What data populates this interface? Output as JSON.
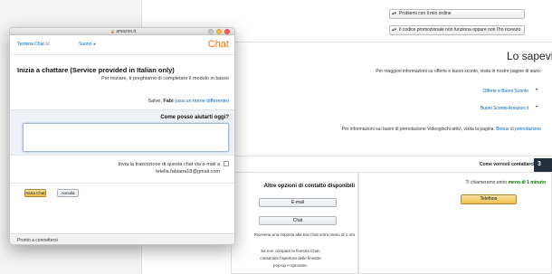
{
  "background": {
    "select1": "Problemi con il mio ordine",
    "select2": "Il codice promozionale non funziona oppure non l'ho ricevuto",
    "section_title": "Lo sapevi?",
    "info_text": "Per maggiori informazioni su offerte e buoni sconto, visita le nostre pagine di aiuto:",
    "link1": "Offerte e Buoni Sconto",
    "link2": "Buoni Sconto Amazon.it",
    "info2_prefix": "Per informazioni sui buoni di prenotazione Videogiochi attivi, visita la pagina:",
    "info2_link": "Bonus di prenotazione",
    "bar_label": "Come vorresti contattarci?",
    "bar_number": "3",
    "right_text_prefix": "Ti chiameremo entro",
    "right_text_bold": "meno di 1 minuto",
    "phone_button": "Telefono",
    "alt_title": "Altre opzioni di contatto disponibili",
    "email_button": "E-mail",
    "chat_button": "Chat",
    "alt_note": "Riceverai una risposta alla tua Chat entro meno di 1 ora",
    "popup_note_1": "Se non compare la finestra Chat,",
    "popup_note_2": "consentire l'apertura delle finestre",
    "popup_note_3": "pop-up e riprovare."
  },
  "window": {
    "title": "amazon.it",
    "toolbar": {
      "chat_title": "Chat",
      "sound": "Suono",
      "end_chat": "Termina Chat"
    },
    "heading": "Inizia a chattare (Service provided in Italian only)",
    "subtitle": "Per iniziare, ti preghiamo di completare il modulo in basso",
    "greeting_prefix": "Salve,",
    "greeting_name": "Fabi",
    "greeting_link": "(usa un nome differente)",
    "question_label": "Come posso aiutarti oggi?",
    "transcript_line1": "Invia la trascrizione di questa chat via e-mail a",
    "transcript_line2": "letella.fabiana18@gmail.com",
    "start_button": "Inizia Chat",
    "cancel_button": "Annulla",
    "status": "Pronto a connettersi"
  },
  "colors": {
    "accent": "#e47911",
    "link": "#0066c0",
    "button_yellow": "#f0c14b"
  }
}
